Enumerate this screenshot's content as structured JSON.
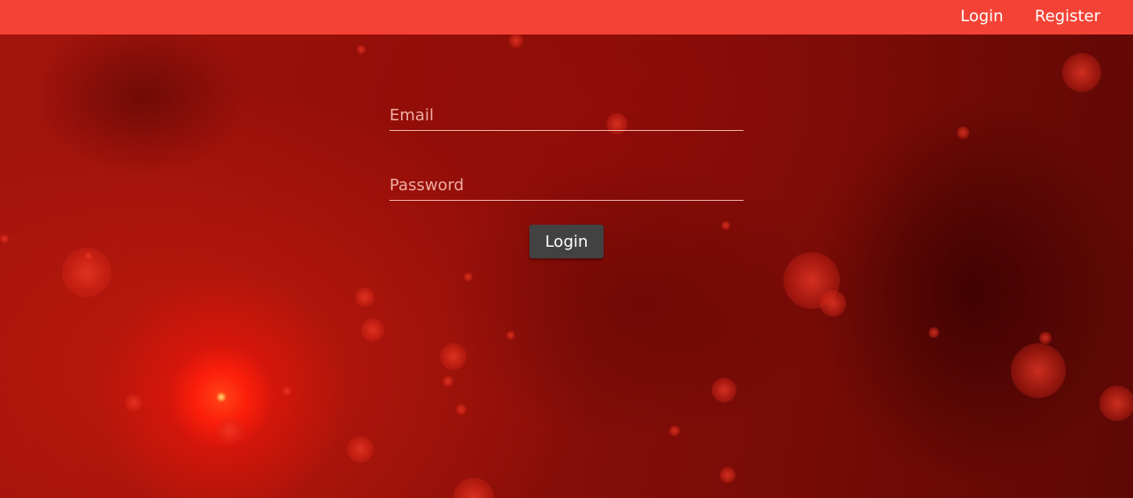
{
  "nav": {
    "login_label": "Login",
    "register_label": "Register",
    "bar_color": "#f44336"
  },
  "form": {
    "email_placeholder": "Email",
    "email_value": "",
    "password_placeholder": "Password",
    "password_value": "",
    "submit_label": "Login"
  },
  "theme": {
    "background_color": "#8e0f09",
    "button_color": "#424242"
  }
}
